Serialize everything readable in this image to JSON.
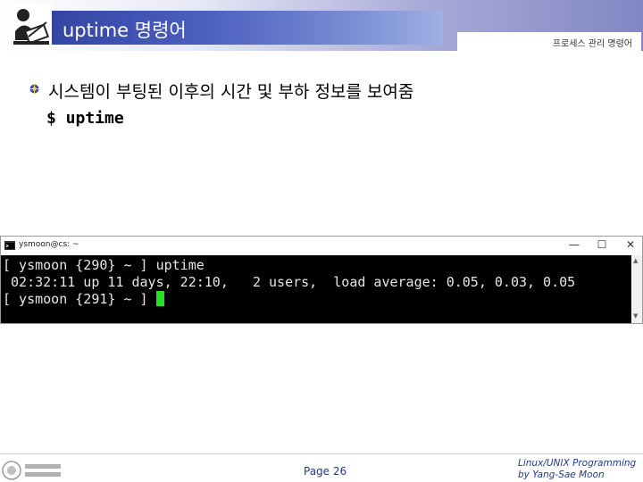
{
  "header": {
    "title": "uptime 명령어",
    "section": "프로세스 관리 명령어"
  },
  "content": {
    "description": "시스템이 부팅된 이후의 시간 및 부하 정보를 보여줌",
    "command": "$ uptime"
  },
  "terminal": {
    "window_title": "ysmoon@cs: ~",
    "buttons": {
      "minimize": "—",
      "maximize": "☐",
      "close": "✕"
    },
    "lines": [
      "[ ysmoon {290} ~ ] uptime",
      " 02:32:11 up 11 days, 22:10,   2 users,  load average: 0.05, 0.03, 0.05",
      "[ ysmoon {291} ~ ] "
    ],
    "cursor_color": "#22e022"
  },
  "footer": {
    "page": "Page 26",
    "credit_line1": "Linux/UNIX Programming",
    "credit_line2": "by Yang-Sae Moon"
  }
}
